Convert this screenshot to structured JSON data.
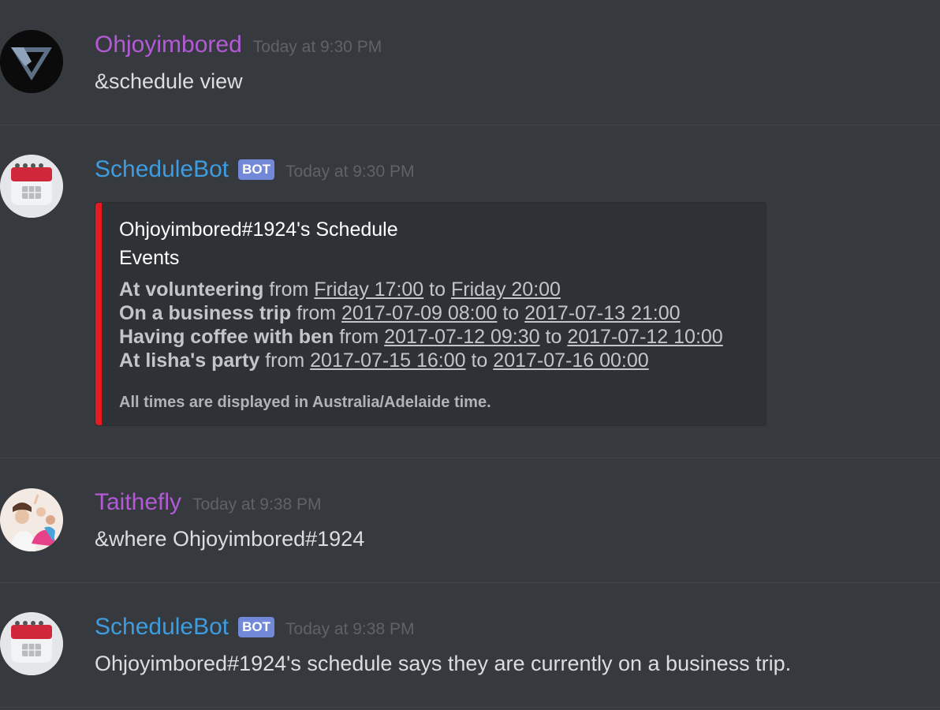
{
  "colors": {
    "background": "#36393e",
    "user_purple": "#b45ad8",
    "bot_blue": "#3d9de0",
    "bot_tag": "#7289da",
    "embed_accent": "#e91920"
  },
  "messages": [
    {
      "author": "Ohjoyimbored",
      "timestamp": "Today at 9:30 PM",
      "text": "&schedule view"
    },
    {
      "author": "ScheduleBot",
      "bot_tag": "BOT",
      "timestamp": "Today at 9:30 PM",
      "embed": {
        "title": "Ohjoyimbored#1924's Schedule",
        "field_name": "Events",
        "events": [
          {
            "name": "At volunteering",
            "from_word": "from",
            "start": "Friday 17:00",
            "to_word": "to",
            "end": "Friday 20:00"
          },
          {
            "name": "On a business trip",
            "from_word": "from",
            "start": "2017-07-09 08:00",
            "to_word": "to",
            "end": "2017-07-13 21:00"
          },
          {
            "name": "Having coffee with ben",
            "from_word": "from",
            "start": "2017-07-12 09:30",
            "to_word": "to",
            "end": "2017-07-12 10:00"
          },
          {
            "name": "At lisha's party",
            "from_word": "from",
            "start": "2017-07-15 16:00",
            "to_word": "to",
            "end": "2017-07-16 00:00"
          }
        ],
        "note": "All times are displayed in Australia/Adelaide time."
      }
    },
    {
      "author": "Taithefly",
      "timestamp": "Today at 9:38 PM",
      "text": "&where Ohjoyimbored#1924"
    },
    {
      "author": "ScheduleBot",
      "bot_tag": "BOT",
      "timestamp": "Today at 9:38 PM",
      "text": "Ohjoyimbored#1924's schedule says they are currently on a business trip."
    }
  ]
}
